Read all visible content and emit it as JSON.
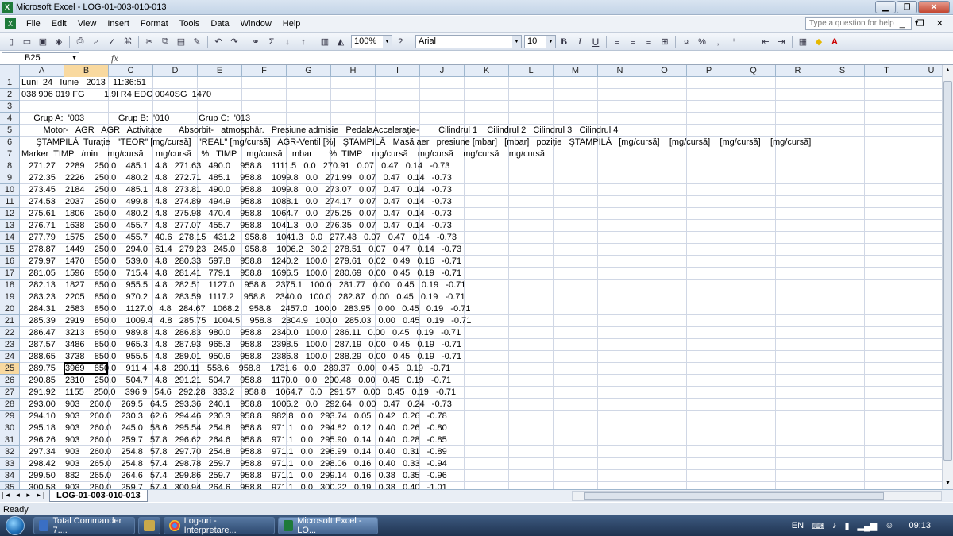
{
  "window": {
    "title": "Microsoft Excel - LOG-01-003-010-013",
    "app_icon": "X"
  },
  "menu": {
    "items": [
      "File",
      "Edit",
      "View",
      "Insert",
      "Format",
      "Tools",
      "Data",
      "Window",
      "Help"
    ],
    "question_placeholder": "Type a question for help"
  },
  "toolbar": {
    "zoom": "100%",
    "font_name": "Arial",
    "font_size": "10"
  },
  "formula_bar": {
    "name_box": "B25",
    "fx": "fx"
  },
  "columns": [
    "A",
    "B",
    "C",
    "D",
    "E",
    "F",
    "G",
    "H",
    "I",
    "J",
    "K",
    "L",
    "M",
    "N",
    "O",
    "P",
    "Q",
    "R",
    "S",
    "T",
    "U"
  ],
  "selected_column": "B",
  "selected_row": "25",
  "rows": [
    {
      "n": "1",
      "text": "Luni  24   Iunie   2013   11:36:51"
    },
    {
      "n": "2",
      "text": "038 906 019 FG        1.9l R4 EDC 0040SG  1470"
    },
    {
      "n": "3",
      "text": ""
    },
    {
      "n": "4",
      "text": "     Grup A:  '003              Grup B:  '010            Grup C:  '013"
    },
    {
      "n": "5",
      "text": "         Motor-   AGR   AGR   Activitate       Absorbit-   atmosphär.   Presiune admisie   PedalaAcceleraţie-        Cilindrul 1    Cilindrul 2   Cilindrul 3   Cilindrul 4"
    },
    {
      "n": "6",
      "text": "      ŞTAMPILĂ  Turaţie   \"TEOR\" [mg/cursă]   \"REAL\" [mg/cursă]   AGR-Ventil [%]   ŞTAMPILĂ   Masă aer   presiune [mbar]   [mbar]   poziţie   ŞTAMPILĂ   [mg/cursă]    [mg/cursă]    [mg/cursă]    [mg/cursă]"
    },
    {
      "n": "7",
      "text": "Marker  TIMP   /min    mg/cursă     mg/cursă    %   TIMP    mg/cursă    mbar       %  TIMP    mg/cursă    mg/cursă    mg/cursă    mg/cursă"
    },
    {
      "n": "8",
      "text": "   271.27    2289    250.0    485.1   4.8   271.63   490.0    958.8    1111.5   0.0   270.91   0.07   0.47   0.14   -0.73"
    },
    {
      "n": "9",
      "text": "   272.35    2226    250.0    480.2   4.8   272.71   485.1    958.8    1099.8   0.0   271.99   0.07   0.47   0.14   -0.73"
    },
    {
      "n": "10",
      "text": "   273.45    2184    250.0    485.1   4.8   273.81   490.0    958.8    1099.8   0.0   273.07   0.07   0.47   0.14   -0.73"
    },
    {
      "n": "11",
      "text": "   274.53    2037    250.0    499.8   4.8   274.89   494.9    958.8    1088.1   0.0   274.17   0.07   0.47   0.14   -0.73"
    },
    {
      "n": "12",
      "text": "   275.61    1806    250.0    480.2   4.8   275.98   470.4    958.8    1064.7   0.0   275.25   0.07   0.47   0.14   -0.73"
    },
    {
      "n": "13",
      "text": "   276.71    1638    250.0    455.7   4.8   277.07   455.7    958.8    1041.3   0.0   276.35   0.07   0.47   0.14   -0.73"
    },
    {
      "n": "14",
      "text": "   277.79    1575    250.0    455.7   40.6   278.15   431.2    958.8    1041.3   0.0   277.43   0.07   0.47   0.14   -0.73"
    },
    {
      "n": "15",
      "text": "   278.87    1449    250.0    294.0   61.4   279.23   245.0    958.8    1006.2   30.2   278.51   0.07   0.47   0.14   -0.73"
    },
    {
      "n": "16",
      "text": "   279.97    1470    850.0    539.0   4.8   280.33   597.8    958.8    1240.2   100.0   279.61   0.02   0.49   0.16   -0.71"
    },
    {
      "n": "17",
      "text": "   281.05    1596    850.0    715.4   4.8   281.41   779.1    958.8    1696.5   100.0   280.69   0.00   0.45   0.19   -0.71"
    },
    {
      "n": "18",
      "text": "   282.13    1827    850.0    955.5   4.8   282.51   1127.0    958.8    2375.1   100.0   281.77   0.00   0.45   0.19   -0.71"
    },
    {
      "n": "19",
      "text": "   283.23    2205    850.0    970.2   4.8   283.59   1117.2    958.8    2340.0   100.0   282.87   0.00   0.45   0.19   -0.71"
    },
    {
      "n": "20",
      "text": "   284.31    2583    850.0    1127.0   4.8   284.67   1068.2    958.8    2457.0   100.0   283.95   0.00   0.45   0.19   -0.71"
    },
    {
      "n": "21",
      "text": "   285.39    2919    850.0    1009.4   4.8   285.75   1004.5    958.8    2304.9   100.0   285.03   0.00   0.45   0.19   -0.71"
    },
    {
      "n": "22",
      "text": "   286.47    3213    850.0    989.8   4.8   286.83   980.0    958.8    2340.0   100.0   286.11   0.00   0.45   0.19   -0.71"
    },
    {
      "n": "23",
      "text": "   287.57    3486    850.0    965.3   4.8   287.93   965.3    958.8    2398.5   100.0   287.19   0.00   0.45   0.19   -0.71"
    },
    {
      "n": "24",
      "text": "   288.65    3738    850.0    955.5   4.8   289.01   950.6    958.8    2386.8   100.0   288.29   0.00   0.45   0.19   -0.71"
    },
    {
      "n": "25",
      "text": "   289.75    3969    850.0    911.4   4.8   290.11   558.6    958.8    1731.6   0.0   289.37   0.00   0.45   0.19   -0.71"
    },
    {
      "n": "26",
      "text": "   290.85    2310    250.0    504.7   4.8   291.21   504.7    958.8    1170.0   0.0   290.48   0.00   0.45   0.19   -0.71"
    },
    {
      "n": "27",
      "text": "   291.92    1155    250.0    396.9   54.6   292.28   333.2    958.8    1064.7   0.0   291.57   0.00   0.45   0.19   -0.71"
    },
    {
      "n": "28",
      "text": "   293.00    903    260.0    269.5   64.5   293.36   240.1    958.8    1006.2   0.0   292.64   0.00   0.47   0.24   -0.73"
    },
    {
      "n": "29",
      "text": "   294.10    903    260.0    230.3   62.6   294.46   230.3    958.8    982.8   0.0   293.74   0.05   0.42   0.26   -0.78"
    },
    {
      "n": "30",
      "text": "   295.18    903    260.0    245.0   58.6   295.54   254.8    958.8    971.1   0.0   294.82   0.12   0.40   0.26   -0.80"
    },
    {
      "n": "31",
      "text": "   296.26    903    260.0    259.7   57.8   296.62   264.6    958.8    971.1   0.0   295.90   0.14   0.40   0.28   -0.85"
    },
    {
      "n": "32",
      "text": "   297.34    903    260.0    254.8   57.8   297.70   254.8    958.8    971.1   0.0   296.99   0.14   0.40   0.31   -0.89"
    },
    {
      "n": "33",
      "text": "   298.42    903    265.0    254.8   57.4   298.78   259.7    958.8    971.1   0.0   298.06   0.16   0.40   0.33   -0.94"
    },
    {
      "n": "34",
      "text": "   299.50    882    265.0    264.6   57.4   299.86   259.7    958.8    971.1   0.0   299.14   0.16   0.38   0.35   -0.96"
    },
    {
      "n": "35",
      "text": "   300.58    903    260.0    259.7   57.4   300.94   264.6    958.8    971.1   0.0   300.22   0.19   0.38   0.40   -1.01"
    }
  ],
  "sheet": {
    "tab": "LOG-01-003-010-013"
  },
  "status": {
    "text": "Ready"
  },
  "taskbar": {
    "items": [
      "Total Commander 7....",
      "Log-uri - Interpretare...",
      "Microsoft Excel - LO..."
    ],
    "lang": "EN",
    "clock": "09:13"
  },
  "colors": {
    "selection_header": "#f9d99f",
    "header_bg": "#e4ecf7",
    "gridline": "#d0d7e5"
  }
}
